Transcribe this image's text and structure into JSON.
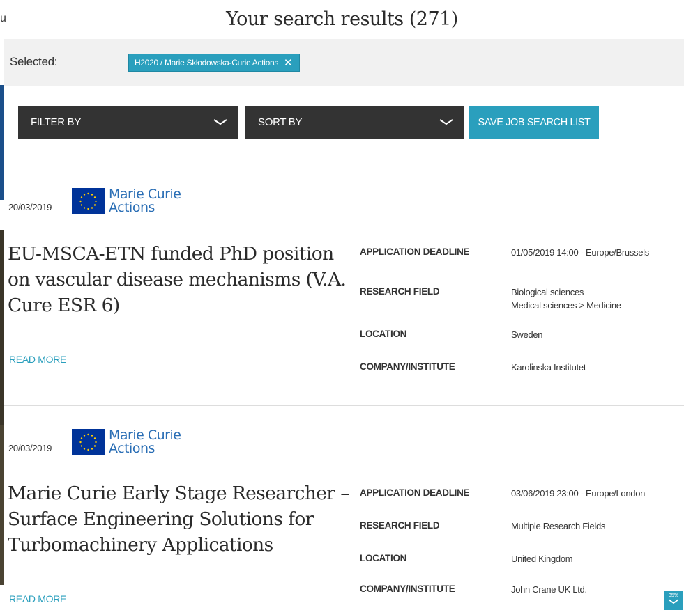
{
  "page": {
    "title": "Your search results (271)"
  },
  "filters": {
    "selected_label": "Selected:",
    "chip_label": "H2020 / Marie Skłodowska-Curie Actions",
    "chip_close": "X"
  },
  "toolbar": {
    "filter_label": "FILTER BY",
    "sort_label": "SORT BY",
    "save_label": "SAVE JOB SEARCH LIST"
  },
  "logo": {
    "line1": "Marie Curie",
    "line2": "Actions"
  },
  "field_labels": {
    "deadline": "APPLICATION DEADLINE",
    "research_field": "RESEARCH FIELD",
    "location": "LOCATION",
    "company": "COMPANY/INSTITUTE"
  },
  "jobs": [
    {
      "date": "20/03/2019",
      "title": "EU-MSCA-ETN funded PhD position on vascular disease mechanisms (V.A. Cure ESR 6)",
      "read_more": "READ MORE",
      "deadline": "01/05/2019 14:00 - Europe/Brussels",
      "research_field_1": "Biological sciences",
      "research_field_2": "Medical sciences > Medicine",
      "location": "Sweden",
      "company": "Karolinska Institutet"
    },
    {
      "date": "20/03/2019",
      "title": "Marie Curie Early Stage Researcher – Surface Engineering Solutions for Turbomachinery Applications",
      "read_more": "READ MORE",
      "deadline": "03/06/2019 23:00 - Europe/London",
      "research_field_1": "Multiple Research Fields",
      "location": "United Kingdom",
      "company": "John Crane UK Ltd."
    }
  ],
  "scroll_badge": {
    "percent": "35%"
  },
  "edge": {
    "char": "u"
  },
  "colors": {
    "accent": "#2a9fbd",
    "dark": "#333333",
    "eu_blue": "#003399",
    "logo_text": "#2a6eb5"
  }
}
